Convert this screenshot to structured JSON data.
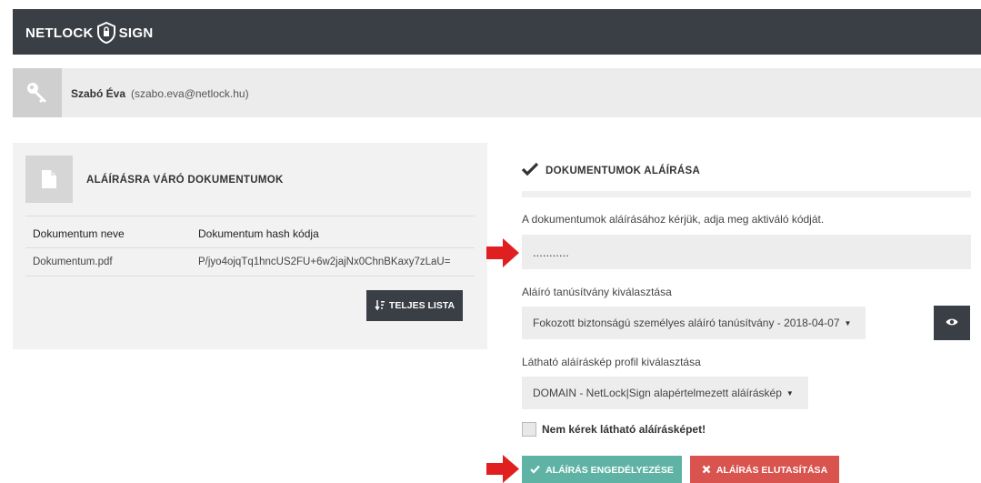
{
  "header": {
    "brand_left": "NETLOCK",
    "brand_right": "SIGN"
  },
  "user": {
    "name": "Szabó Éva",
    "email": "(szabo.eva@netlock.hu)",
    "icon": "key-icon"
  },
  "documents": {
    "title": "ALÁÍRÁSRA VÁRÓ DOKUMENTUMOK",
    "icon": "document-icon",
    "columns": [
      "Dokumentum neve",
      "Dokumentum hash kódja"
    ],
    "rows": [
      [
        "Dokumentum.pdf",
        "P/jyo4ojqTq1hncUS2FU+6w2jajNx0ChnBKaxy7zLaU="
      ]
    ],
    "full_list_button": "TELJES LISTA"
  },
  "signing": {
    "title": "DOKUMENTUMOK ALÁÍRÁSA",
    "instruction": "A dokumentumok aláírásához kérjük, adja meg aktiváló kódját.",
    "password_value": "...........",
    "certificate_label": "Aláíró tanúsítvány kiválasztása",
    "certificate_selected": "Fokozott biztonságú személyes aláíró tanúsítvány - 2018-04-07",
    "visual_label": "Látható aláíráskép profil kiválasztása",
    "visual_selected": "DOMAIN - NetLock|Sign alapértelmezett aláíráskép",
    "no_visual_checkbox": "Nem kérek látható aláírásképet!",
    "no_visual_checked": false,
    "approve_button": "ALÁÍRÁS ENGEDÉLYEZÉSE",
    "reject_button": "ALÁÍRÁS ELUTASÍTÁSA"
  },
  "colors": {
    "topbar": "#3a3e45",
    "approve": "#5fb3a5",
    "reject": "#d9534f",
    "arrow": "#e02020"
  }
}
